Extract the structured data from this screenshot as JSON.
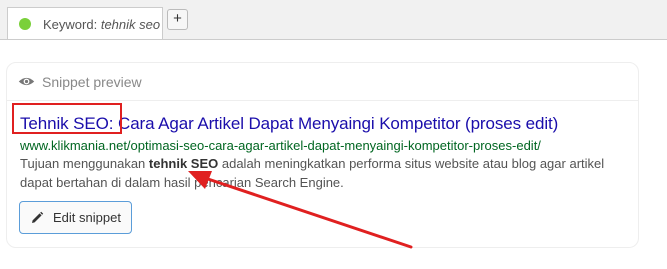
{
  "tab": {
    "label_prefix": "Keyword:",
    "keyword": "tehnik seo",
    "status_color": "#7ad03a"
  },
  "add_button": {
    "label": "+"
  },
  "snippet_preview": {
    "heading": "Snippet preview",
    "heading_icon": "eye-icon",
    "title_keyword": "Tehnik SEO:",
    "title_rest": " Cara Agar Artikel Dapat Menyaingi Kompetitor (proses edit)",
    "url": "www.klikmania.net/optimasi-seo-cara-agar-artikel-dapat-menyaingi-kompetitor-proses-edit/",
    "desc_before": "Tujuan menggunakan ",
    "desc_bold": "tehnik SEO",
    "desc_after": " adalah meningkatkan performa situs website atau blog agar artikel dapat bertahan di dalam hasil pencarian Search Engine."
  },
  "edit_button": {
    "label": "Edit snippet",
    "icon": "pencil-icon"
  },
  "colors": {
    "title_link": "#1a0dab",
    "url": "#006621",
    "annotation": "#e02020",
    "button_border": "#5b9dd9"
  }
}
